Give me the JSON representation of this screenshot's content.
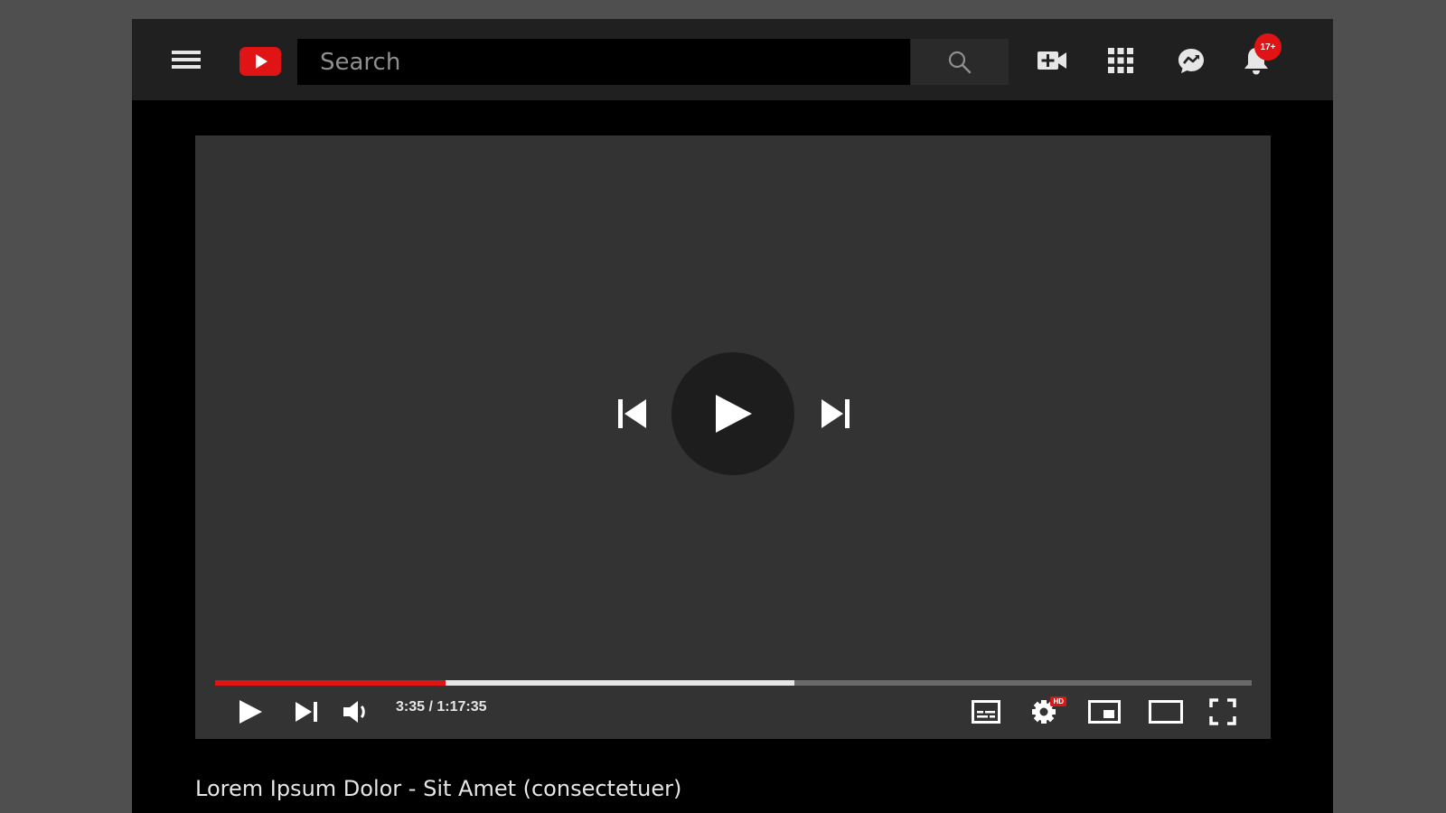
{
  "search": {
    "placeholder": "Search"
  },
  "header": {
    "notification_count": "17+"
  },
  "player": {
    "current_time": "3:35",
    "duration": "1:17:35",
    "time_display": "3:35 / 1:17:35",
    "played_fraction": 0.222,
    "buffered_fraction": 0.559,
    "quality_badge": "HD"
  },
  "video": {
    "title": "Lorem Ipsum Dolor - Sit Amet (consectetuer)"
  },
  "colors": {
    "accent": "#e01414",
    "topbar_bg": "#202020",
    "player_bg": "#333333",
    "page_bg": "#4f4f4f"
  },
  "icons": {
    "menu": "hamburger-menu-icon",
    "logo": "youtube-logo-icon",
    "search": "search-icon",
    "create": "video-camera-plus-icon",
    "apps": "apps-grid-icon",
    "messages": "chat-bubble-icon",
    "notifications": "bell-icon",
    "previous": "skip-previous-icon",
    "play": "play-icon",
    "next": "skip-next-icon",
    "volume": "volume-icon",
    "subtitles": "subtitles-icon",
    "settings": "settings-gear-icon",
    "miniplayer": "miniplayer-icon",
    "theater": "theater-mode-icon",
    "fullscreen": "fullscreen-icon"
  }
}
